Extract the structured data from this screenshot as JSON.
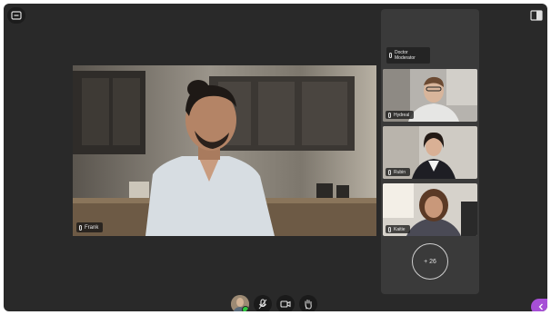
{
  "main_speaker": {
    "name": "Frank"
  },
  "sidebar": {
    "moderator": {
      "name": "Doctor",
      "role": "Moderator"
    },
    "thumbnails": [
      {
        "name": "Hydreal"
      },
      {
        "name": "Rubin"
      },
      {
        "name": "Kaitie"
      }
    ],
    "overflow_count": "+ 26"
  },
  "icons": {
    "top_left": "leave-icon",
    "top_right": "layout-toggle-icon",
    "toolbar": [
      "microphone-icon",
      "video-camera-icon",
      "raise-hand-icon"
    ],
    "chat": "chat-icon"
  },
  "colors": {
    "background": "#292929",
    "accent": "#a64fd6",
    "status_online": "#2ecc40"
  }
}
